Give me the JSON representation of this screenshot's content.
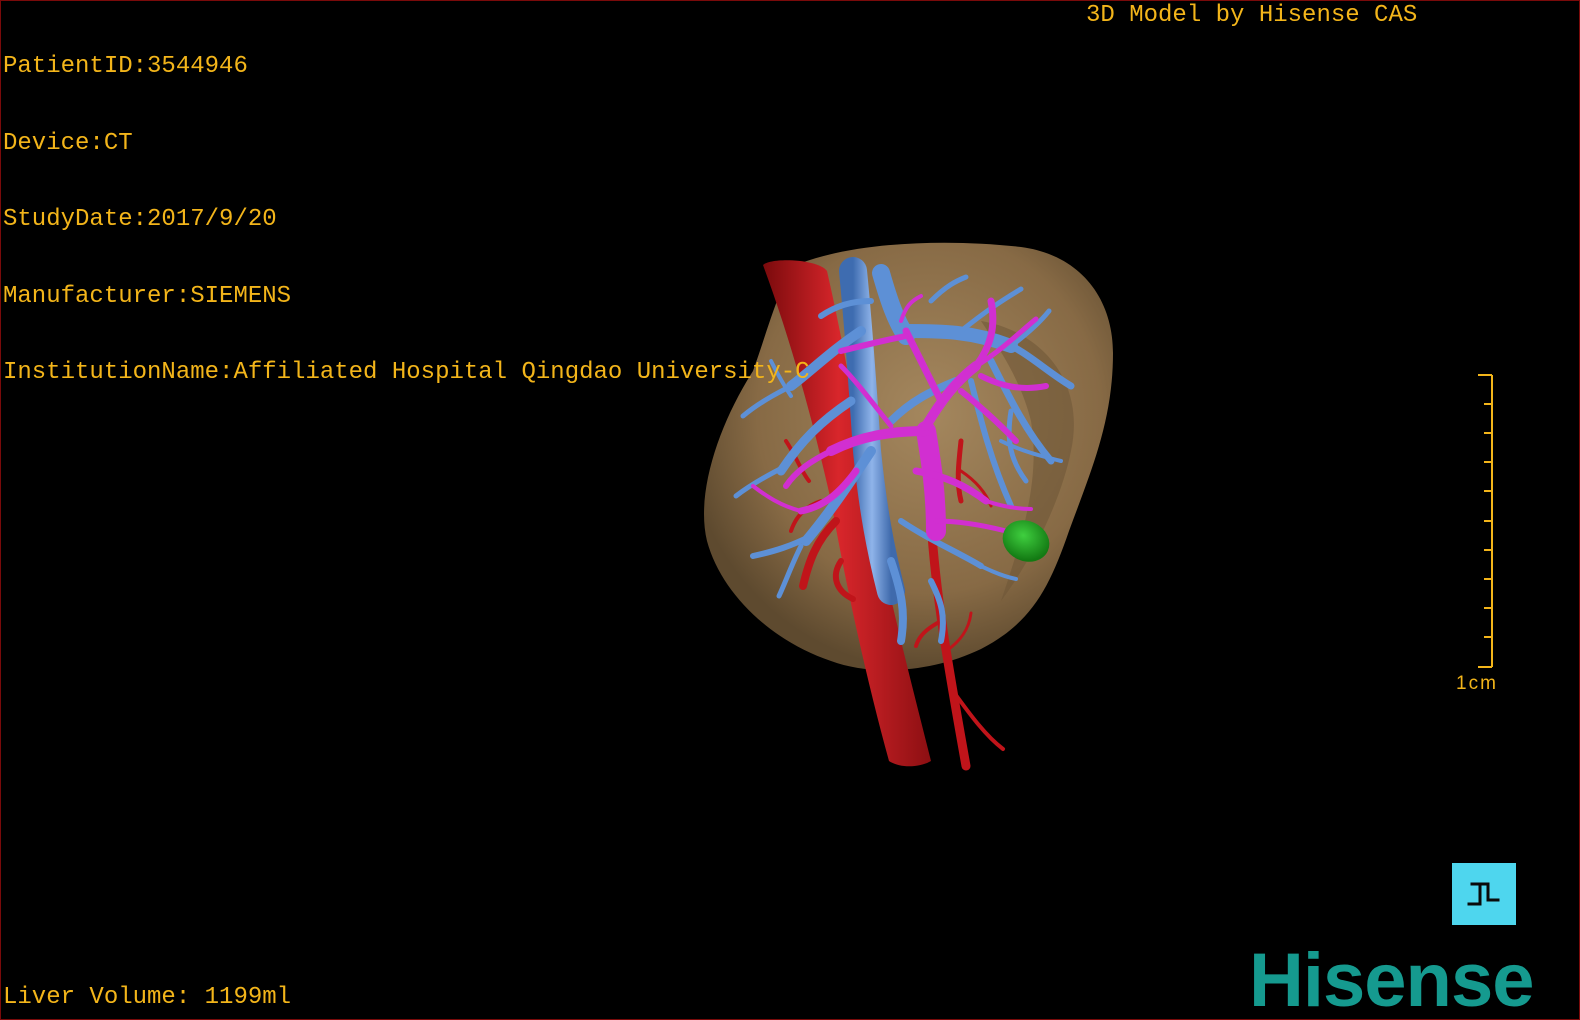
{
  "header_info": {
    "patient_id": "PatientID:3544946",
    "device": "Device:CT",
    "study_date": "StudyDate:2017/9/20",
    "manufacturer": "Manufacturer:SIEMENS",
    "institution": "InstitutionName:Affiliated Hospital Qingdao University-C"
  },
  "model_credit": "3D Model by Hisense CAS",
  "liver_volume": "Liver Volume: 1199ml",
  "scale_bar": {
    "label": "1cm"
  },
  "brand": {
    "logo_text": "Hisense"
  },
  "colors": {
    "overlay_text": "#f3b51a",
    "liver": "#8f7450",
    "artery": "#c0141a",
    "hepatic_vein": "#5d90d6",
    "portal_vein": "#d12fd1",
    "lesion": "#1e9c1e",
    "orientation_button": "#4ed6ee",
    "brand": "#159a8f"
  },
  "icons": {
    "orientation_cube": "orientation-cube-icon"
  }
}
